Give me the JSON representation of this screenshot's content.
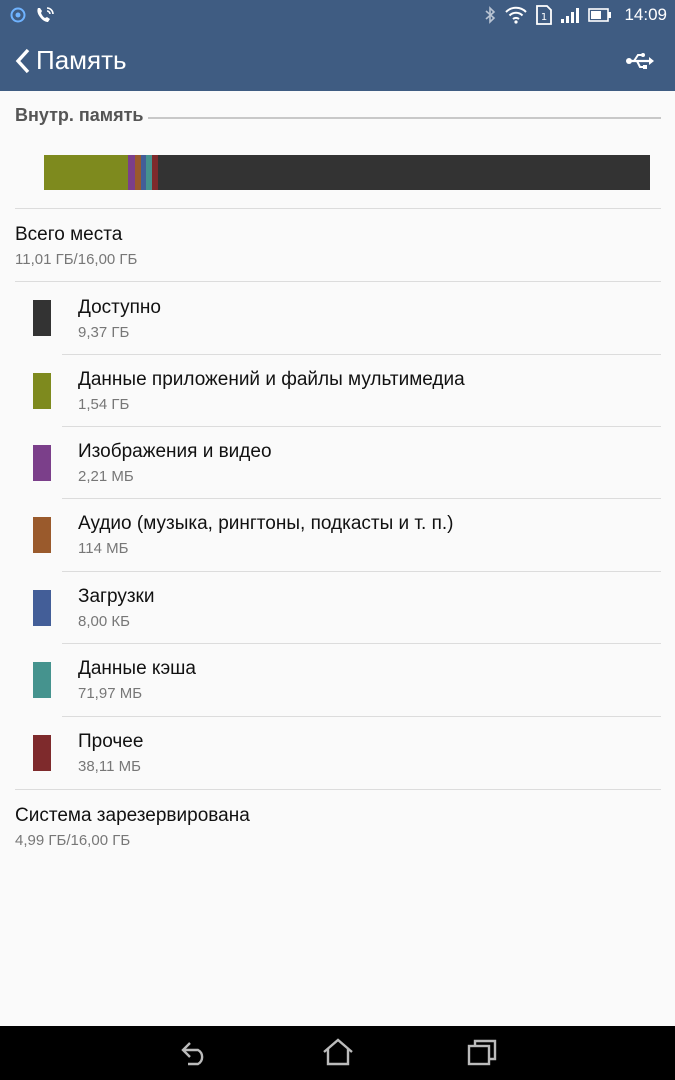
{
  "status_bar": {
    "time": "14:09",
    "sim_label": "1",
    "icons": [
      "assistant-icon",
      "phone-call-icon",
      "bluetooth-icon",
      "wifi-icon",
      "sim-icon",
      "signal-icon",
      "battery-icon"
    ]
  },
  "action_bar": {
    "title": "Память",
    "back_icon": "chevron-left-icon",
    "usb_icon": "usb-icon"
  },
  "storage": {
    "section_title": "Внутр. память",
    "total": {
      "label": "Всего места",
      "value": "11,01 ГБ/16,00 ГБ"
    },
    "items": [
      {
        "label": "Доступно",
        "value": "9,37 ГБ",
        "color": "#333333"
      },
      {
        "label": "Данные приложений и файлы мультимедиа",
        "value": "1,54 ГБ",
        "color": "#7e8a1e"
      },
      {
        "label": "Изображения и видео",
        "value": "2,21 МБ",
        "color": "#7b3f8a"
      },
      {
        "label": "Аудио (музыка, рингтоны, подкасты и т. п.)",
        "value": "114 МБ",
        "color": "#9a5a2c"
      },
      {
        "label": "Загрузки",
        "value": "8,00 КБ",
        "color": "#435e98"
      },
      {
        "label": "Данные кэша",
        "value": "71,97 МБ",
        "color": "#45938e"
      },
      {
        "label": "Прочее",
        "value": "38,11 МБ",
        "color": "#7e2a2c"
      }
    ],
    "system": {
      "label": "Система зарезервирована",
      "value": "4,99 ГБ/16,00 ГБ"
    },
    "bar_segments": [
      {
        "name": "app-data",
        "fraction": 0.138,
        "color": "#7e8a1e"
      },
      {
        "name": "images",
        "fraction": 0.012,
        "color": "#7b3f8a"
      },
      {
        "name": "audio",
        "fraction": 0.01,
        "color": "#9a5a2c"
      },
      {
        "name": "downloads",
        "fraction": 0.008,
        "color": "#435e98"
      },
      {
        "name": "cache",
        "fraction": 0.01,
        "color": "#45938e"
      },
      {
        "name": "misc",
        "fraction": 0.01,
        "color": "#7e2a2c"
      },
      {
        "name": "available",
        "fraction": 0.812,
        "color": "#333333"
      }
    ]
  },
  "nav_bar": {
    "icons": [
      "back-icon",
      "home-icon",
      "recent-apps-icon"
    ]
  }
}
